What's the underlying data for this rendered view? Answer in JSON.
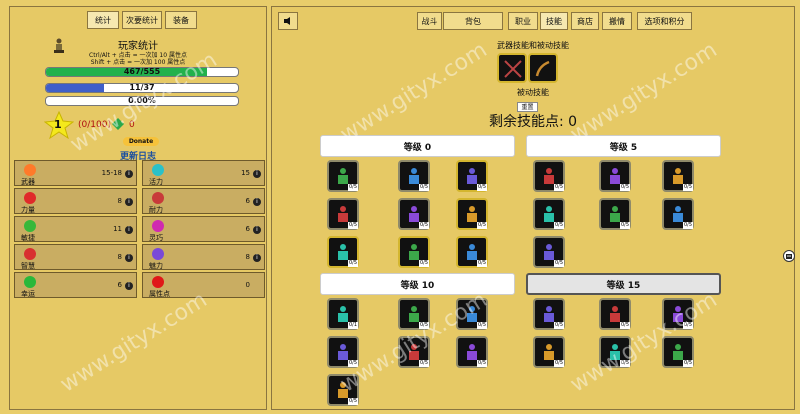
{
  "left": {
    "tabs": [
      "统计",
      "次要统计",
      "装备"
    ],
    "title": "玩家统计",
    "hint1": "Ctrl/Alt + 点击 = 一次加 10 属性点",
    "hint2": "Shift + 点击 = 一次加 100 属性点",
    "bars": [
      {
        "text": "467/555",
        "fraction": 0.84,
        "color": "#22b14c"
      },
      {
        "text": "11/37",
        "fraction": 0.3,
        "color": "#3f5fc9"
      },
      {
        "text": "0.00%",
        "fraction": 0.0,
        "color": "#c9a53f"
      }
    ],
    "level": "1",
    "exp": "(0/100)",
    "points": "0",
    "donate": "Donate",
    "changelog": "更新日志",
    "stats": [
      {
        "label": "武器",
        "value": "15-18",
        "icon": "fist-icon",
        "color": "#ff7a2a"
      },
      {
        "label": "活力",
        "value": "15",
        "icon": "vitality-icon",
        "color": "#2ac1c9"
      },
      {
        "label": "力量",
        "value": "8",
        "icon": "strength-icon",
        "color": "#e02a2a"
      },
      {
        "label": "耐力",
        "value": "6",
        "icon": "endurance-icon",
        "color": "#c83a3a"
      },
      {
        "label": "敏捷",
        "value": "11",
        "icon": "agility-icon",
        "color": "#38b83a"
      },
      {
        "label": "灵巧",
        "value": "6",
        "icon": "dexterity-icon",
        "color": "#d02ab0"
      },
      {
        "label": "智慧",
        "value": "8",
        "icon": "wisdom-icon",
        "color": "#d83030"
      },
      {
        "label": "魅力",
        "value": "8",
        "icon": "charisma-icon",
        "color": "#7a4ad8"
      },
      {
        "label": "幸运",
        "value": "6",
        "icon": "luck-icon",
        "color": "#2ab83a"
      },
      {
        "label": "属性点",
        "value": "0",
        "icon": "plus-icon",
        "color": "#e01818"
      }
    ]
  },
  "right": {
    "tabs": [
      "战斗",
      "背包",
      "职业",
      "技能",
      "商店",
      "搬情",
      "选项和积分"
    ],
    "active_tab": "技能",
    "section_title": "武器技能和被动技能",
    "passive_label": "被动技能",
    "reset_label": "重置",
    "skill_points": "剩余技能点: 0",
    "groups": [
      {
        "title": "等级 0",
        "counts": [
          "0/5",
          "0/5",
          "0/5",
          "0/5",
          "0/5",
          "0/5",
          "0/5",
          "0/5",
          "0/5"
        ]
      },
      {
        "title": "等级 5",
        "counts": [
          "0/5",
          "0/5",
          "0/5",
          "0/5",
          "0/5",
          "0/5",
          "0/5"
        ]
      },
      {
        "title": "等级 10",
        "counts": [
          "0/1",
          "0/5",
          "0/5",
          "0/5",
          "0/5",
          "0/5",
          "0/5"
        ]
      },
      {
        "title": "等级 15",
        "counts": [
          "0/5",
          "0/5",
          "0/5",
          "0/5",
          "0/5",
          "0/5"
        ]
      }
    ]
  },
  "watermark": "www.gityx.com"
}
